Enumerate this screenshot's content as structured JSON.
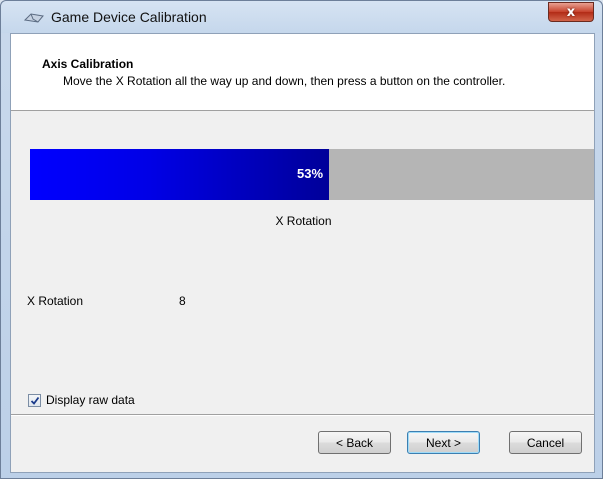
{
  "window": {
    "title": "Game Device Calibration",
    "close_symbol": "x"
  },
  "header": {
    "title": "Axis Calibration",
    "subtitle": "Move the X Rotation all the way up and down, then press a button on the controller."
  },
  "progress": {
    "value_fraction": 0.53,
    "label": "53%",
    "fill_color": "#0000ff",
    "track_color": "#b5b5b5"
  },
  "axis": {
    "caption": "X Rotation"
  },
  "raw": {
    "label": "X Rotation",
    "value": "8"
  },
  "options": {
    "display_raw_label": "Display raw data",
    "display_raw_checked": true
  },
  "buttons": {
    "back": "< Back",
    "next": "Next >",
    "cancel": "Cancel"
  },
  "icons": {
    "app": "game-controller-icon",
    "close": "close-icon",
    "checkmark": "checkmark-icon"
  }
}
